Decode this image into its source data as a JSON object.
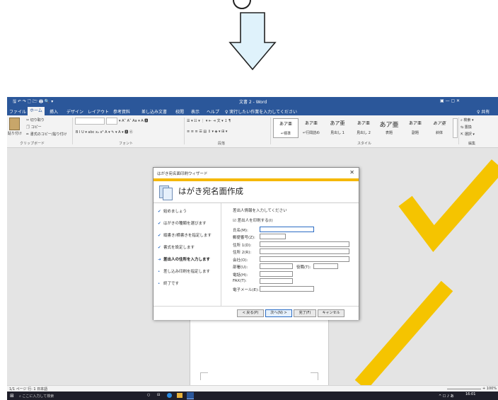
{
  "word": {
    "qat": "🖫 ↶ ↷ 🗋 🗁 🖨 🔍 ▾",
    "title": "文書 2 - Word",
    "window_controls": "▣ — ▢ ✕",
    "tabs": [
      "ファイル",
      "ホーム",
      "挿入",
      "デザイン",
      "レイアウト",
      "参考資料",
      "差し込み文書",
      "校閲",
      "表示",
      "ヘルプ"
    ],
    "tell_me": "♀ 実行したい作業を入力してください",
    "share": "♀ 共有",
    "clipboard": {
      "paste": "貼り付け",
      "cut": "✂ 切り取り",
      "copy": "🗍 コピー",
      "format_painter": "✏ 書式のコピー/貼り付け",
      "label": "クリップボード"
    },
    "font": {
      "size_tools": "▾ A˄ A˅ Aa ▾ A̶ 🅰",
      "format_row": "B I U ▾ abc x₂ x²  A ▾ ✎ ▾ A ▾ 🅰 Ⓐ",
      "label": "フォント"
    },
    "paragraph": {
      "row1": "☰ ▾ ☷ ▾ ⋮ ▾ ⇤ ⇥ 文 ▾ ↧ ¶",
      "row2": "≡ ≡ ≡ ☰ ▤ ↕ ▾ ◈ ▾ ⊞ ▾",
      "label": "段落"
    },
    "styles": {
      "items": [
        {
          "sample": "あア亜",
          "name": "↵標準"
        },
        {
          "sample": "あア亜",
          "name": "↵行間詰め"
        },
        {
          "sample": "あア亜",
          "name": "見出し 1"
        },
        {
          "sample": "あア亜",
          "name": "見出し 2"
        },
        {
          "sample": "あア亜",
          "name": "表題"
        },
        {
          "sample": "あア亜",
          "name": "副題"
        },
        {
          "sample": "あア亜",
          "name": "斜体"
        }
      ],
      "label": "スタイル"
    },
    "editing": {
      "find": "⌕ 検索 ▾",
      "replace": "⇆ 置換",
      "select": "⇱ 選択 ▾",
      "label": "編集"
    },
    "statusbar": {
      "left": "1/1 ページ  行: 1    日本語",
      "zoom": "+ 100%"
    },
    "taskbar": {
      "search": "⌕ ここに入力して検索",
      "time": "16:01",
      "tray": "^ ☐ ♪ あ"
    }
  },
  "dialog": {
    "window_title": "はがき宛名面印刷ウィザード",
    "close": "✕",
    "heading": "はがき宛名面作成",
    "steps": [
      {
        "mark": "✔",
        "label": "始めましょう"
      },
      {
        "mark": "✔",
        "label": "はがきの種類を選びます"
      },
      {
        "mark": "✔",
        "label": "縦書き/横書きを指定します"
      },
      {
        "mark": "✔",
        "label": "書式を設定します"
      },
      {
        "mark": "➜",
        "label": "差出人の住所を入力します"
      },
      {
        "mark": "•",
        "label": "差し込み印刷を指定します"
      },
      {
        "mark": "•",
        "label": "終了です"
      }
    ],
    "instruction": "差出人情報を入力してください",
    "print_sender": "☑ 差出人を印刷する(I)",
    "fields": {
      "name": "氏名(M):",
      "postal": "郵便番号(Z):",
      "addr1": "住所 1(D):",
      "addr2": "住所 2(R):",
      "company": "会社(O):",
      "dept": "部署(U):",
      "title": "役職(T):",
      "phone": "電話(H):",
      "fax": "FAX(T):",
      "email": "電子メール(E):"
    },
    "buttons": {
      "back": "< 戻る(P)",
      "next": "次へ(N) >",
      "finish": "完了(F)",
      "cancel": "キャンセル"
    }
  }
}
